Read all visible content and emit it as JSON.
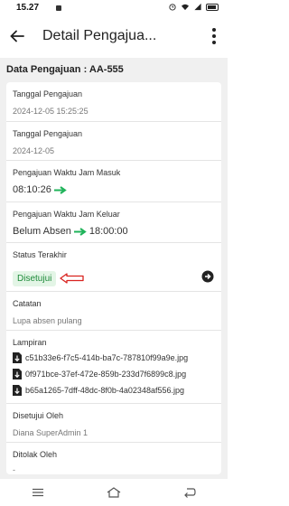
{
  "status_bar": {
    "time": "15.27"
  },
  "app_bar": {
    "title": "Detail Pengajua..."
  },
  "section_title": "Data Pengajuan : AA-555",
  "fields": {
    "tanggal_pengajuan_1": {
      "label": "Tanggal Pengajuan",
      "value": "2024-12-05 15:25:25"
    },
    "tanggal_pengajuan_2": {
      "label": "Tanggal Pengajuan",
      "value": "2024-12-05"
    },
    "jam_masuk": {
      "label": "Pengajuan Waktu Jam Masuk",
      "from": "08:10:26",
      "to": ""
    },
    "jam_keluar": {
      "label": "Pengajuan Waktu Jam Keluar",
      "from": "Belum Absen",
      "to": "18:00:00"
    },
    "status": {
      "label": "Status Terakhir",
      "value": "Disetujui"
    },
    "catatan": {
      "label": "Catatan",
      "value": "Lupa absen pulang"
    },
    "lampiran": {
      "label": "Lampiran",
      "files": [
        "c51b33e6-f7c5-414b-ba7c-787810f99a9e.jpg",
        "0f971bce-37ef-472e-859b-233d7f6899c8.jpg",
        "b65a1265-7dff-48dc-8f0b-4a02348af556.jpg"
      ]
    },
    "disetujui_oleh": {
      "label": "Disetujui Oleh",
      "value": "Diana SuperAdmin 1"
    },
    "ditolak_oleh": {
      "label": "Ditolak Oleh",
      "value": "-"
    }
  },
  "colors": {
    "arrow_green": "#1fb35a",
    "status_green": "#1e8b3a",
    "annotation_red": "#d9231f",
    "background": "#f0f0f0"
  },
  "icons": [
    "back-arrow-icon",
    "more-vert-icon",
    "arrow-right-icon",
    "chevron-circle-right-icon",
    "download-file-icon"
  ]
}
